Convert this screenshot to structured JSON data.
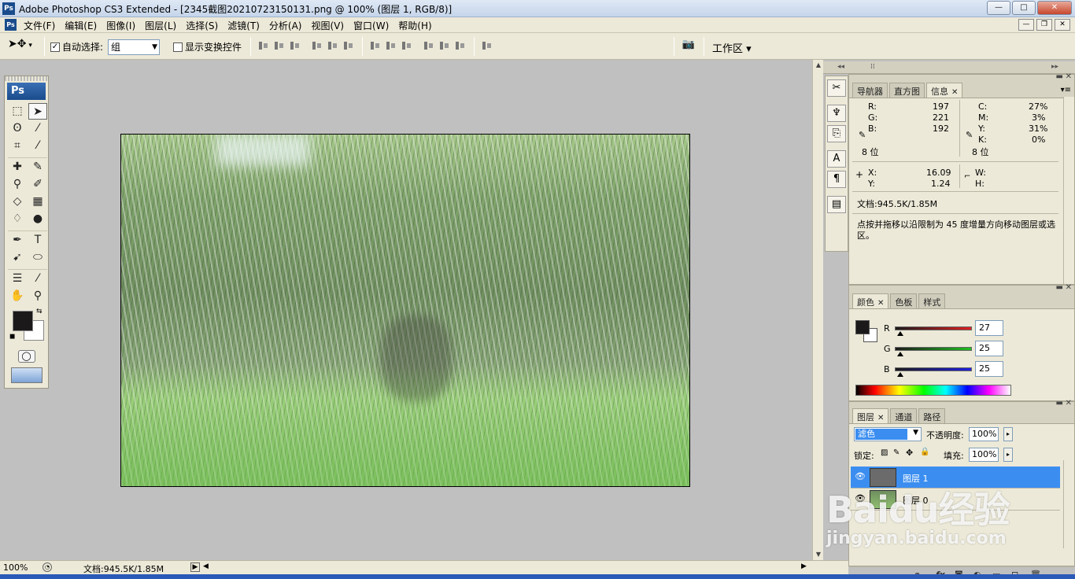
{
  "titlebar": {
    "title": "Adobe Photoshop CS3 Extended - [2345截图20210723150131.png @ 100% (图层 1, RGB/8)]",
    "app_icon": "Ps",
    "minimize": "—",
    "maximize": "□",
    "close": "✕"
  },
  "menubar": {
    "ps_icon": "Ps",
    "items": [
      "文件(F)",
      "编辑(E)",
      "图像(I)",
      "图层(L)",
      "选择(S)",
      "滤镜(T)",
      "分析(A)",
      "视图(V)",
      "窗口(W)",
      "帮助(H)"
    ],
    "doc_minimize": "—",
    "doc_restore": "❐",
    "doc_close": "✕"
  },
  "options": {
    "auto_select_label": "自动选择:",
    "auto_select_checked": "✓",
    "auto_select_value": "组",
    "show_transform_label": "显示变换控件",
    "workspace_label": "工作区 ▾"
  },
  "toolbox": {
    "logo": "Ps",
    "fg_color": "#1b1919",
    "bg_color": "#ffffff"
  },
  "status": {
    "zoom": "100%",
    "docinfo": "文档:945.5K/1.85M"
  },
  "info_panel": {
    "tabs": [
      "导航器",
      "直方图",
      "信息"
    ],
    "active_tab": "信息",
    "rgb": [
      {
        "label": "R:",
        "value": "197"
      },
      {
        "label": "G:",
        "value": "221"
      },
      {
        "label": "B:",
        "value": "192"
      }
    ],
    "cmyk": [
      {
        "label": "C:",
        "value": "27%"
      },
      {
        "label": "M:",
        "value": "3%"
      },
      {
        "label": "Y:",
        "value": "31%"
      },
      {
        "label": "K:",
        "value": "0%"
      }
    ],
    "bits_left": "8 位",
    "bits_right": "8 位",
    "x_label": "X:",
    "x_value": "16.09",
    "y_label": "Y:",
    "y_value": "1.24",
    "w_label": "W:",
    "h_label": "H:",
    "doc": "文档:945.5K/1.85M",
    "hint": "点按并拖移以沿限制为 45 度增量方向移动图层或选区。"
  },
  "color_panel": {
    "tabs": [
      "颜色",
      "色板",
      "样式"
    ],
    "active_tab": "颜色",
    "channels": [
      {
        "label": "R",
        "value": "27",
        "color": "#c0392b"
      },
      {
        "label": "G",
        "value": "25",
        "color": "#27ae60"
      },
      {
        "label": "B",
        "value": "25",
        "color": "#1f3fd1"
      }
    ]
  },
  "layers_panel": {
    "tabs": [
      "图层",
      "通道",
      "路径"
    ],
    "active_tab": "图层",
    "blend_mode": "滤色",
    "opacity_label": "不透明度:",
    "opacity": "100%",
    "lock_label": "锁定:",
    "fill_label": "填充:",
    "fill": "100%",
    "layers": [
      {
        "name": "图层 1",
        "selected": true
      },
      {
        "name": "图层 0",
        "selected": false
      }
    ]
  },
  "watermark": {
    "logo": "Baidu经验",
    "sub": "jingyan.baidu.com"
  }
}
